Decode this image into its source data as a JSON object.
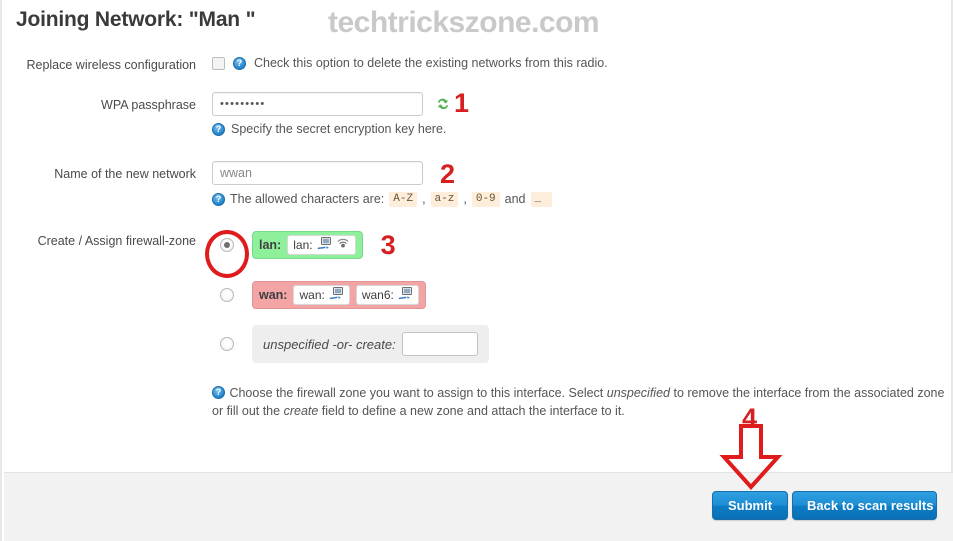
{
  "header": {
    "title": "Joining Network: \"Man \"",
    "watermark": "techtrickszone.com"
  },
  "form": {
    "replace_config": {
      "label": "Replace wireless configuration",
      "checked": false,
      "help": "Check this option to delete the existing networks from this radio."
    },
    "wpa_passphrase": {
      "label": "WPA passphrase",
      "value": "•••••••••",
      "placeholder": "",
      "help": "Specify the secret encryption key here.",
      "reveal_icon": "reveal-password-icon"
    },
    "network_name": {
      "label": "Name of the new network",
      "value": "",
      "placeholder": "wwan",
      "help_prefix": "The allowed characters are:",
      "allowed": [
        "A-Z",
        "a-z",
        "0-9"
      ],
      "help_conjunction": "and",
      "allowed_last": "_"
    },
    "firewall_zone": {
      "label": "Create / Assign firewall-zone",
      "selected_index": 0,
      "options": [
        {
          "name": "lan:",
          "color": "#8ef09a",
          "interfaces": [
            {
              "label": "lan:",
              "icons": [
                "ethernet-icon",
                "wireless-icon"
              ]
            }
          ]
        },
        {
          "name": "wan:",
          "color": "#f3a5a5",
          "interfaces": [
            {
              "label": "wan:",
              "icons": [
                "ethernet-icon"
              ]
            },
            {
              "label": "wan6:",
              "icons": [
                "ethernet-icon"
              ]
            }
          ]
        },
        {
          "name": "unspecified -or- create:",
          "color": "#eeeeee",
          "create_value": "",
          "create_placeholder": ""
        }
      ],
      "help_line1_a": "Choose the firewall zone you want to assign to this interface. Select ",
      "help_em1": "unspecified",
      "help_line1_b": " to remove the interface from the associated",
      "help_line2_a": "zone or fill out the ",
      "help_em2": "create",
      "help_line2_b": " field to define a new zone and attach the interface to it."
    }
  },
  "footer": {
    "submit_label": "Submit",
    "back_label": "Back to scan results"
  },
  "annotations": {
    "one": "1",
    "two": "2",
    "three": "3",
    "four": "4",
    "accent_color": "#d61f20"
  }
}
